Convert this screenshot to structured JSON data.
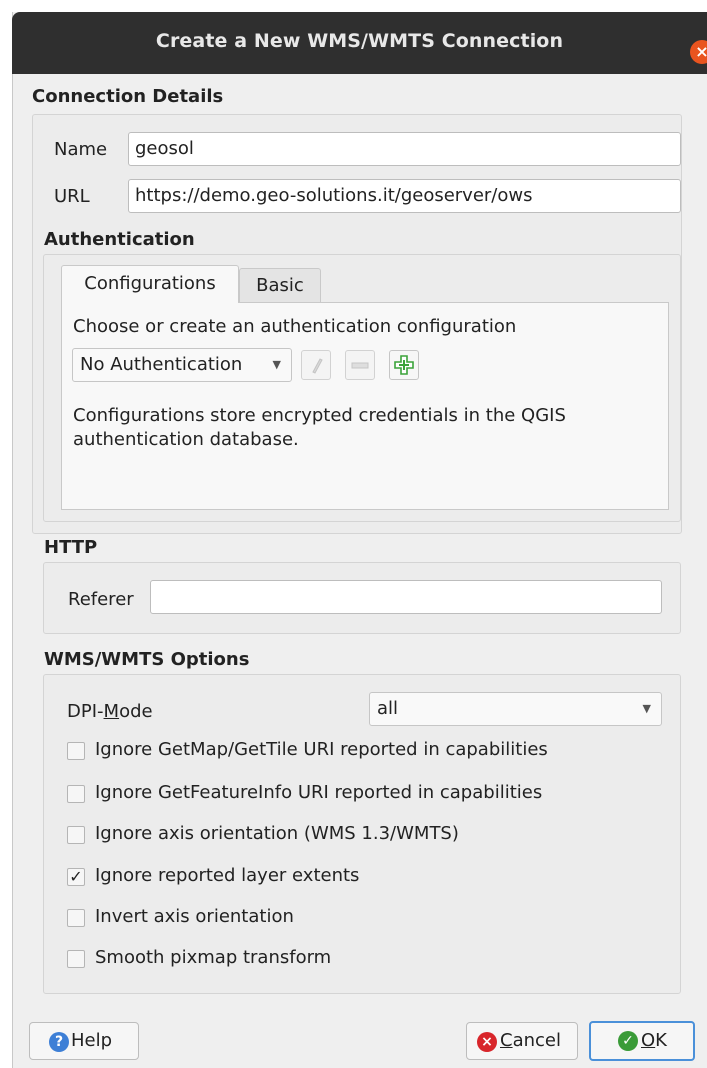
{
  "window": {
    "title": "Create a New WMS/WMTS Connection",
    "close_glyph": "×"
  },
  "connection": {
    "heading": "Connection Details",
    "name_label": "Name",
    "name_value": "geosol",
    "url_label": "URL",
    "url_value": "https://demo.geo-solutions.it/geoserver/ows"
  },
  "auth": {
    "heading": "Authentication",
    "tabs": [
      {
        "label": "Configurations",
        "active": true
      },
      {
        "label": "Basic",
        "active": false
      }
    ],
    "prompt": "Choose or create an authentication configuration",
    "selected": "No Authentication",
    "info_line1": "Configurations store encrypted credentials in the QGIS",
    "info_line2": "authentication database."
  },
  "http": {
    "heading": "HTTP",
    "referer_label": "Referer",
    "referer_value": ""
  },
  "options": {
    "heading": "WMS/WMTS Options",
    "dpi_label_pre": "DPI-",
    "dpi_label_ul": "M",
    "dpi_label_post": "ode",
    "dpi_value": "all",
    "checkboxes": [
      {
        "label": "Ignore GetMap/GetTile URI reported in capabilities",
        "checked": false
      },
      {
        "label": "Ignore GetFeatureInfo URI reported in capabilities",
        "checked": false
      },
      {
        "label": "Ignore axis orientation (WMS 1.3/WMTS)",
        "checked": false
      },
      {
        "label": "Ignore reported layer extents",
        "checked": true
      },
      {
        "label": "Invert axis orientation",
        "checked": false
      },
      {
        "label": "Smooth pixmap transform",
        "checked": false
      }
    ]
  },
  "buttons": {
    "help": "Help",
    "cancel_ul": "C",
    "cancel_rest": "ancel",
    "ok_ul": "O",
    "ok_rest": "K"
  },
  "colors": {
    "help_icon": "#3d7fd6",
    "cancel_icon": "#d8262b",
    "ok_icon": "#3a9b38",
    "add_icon": "#3ba33a",
    "ok_border": "#4a90d9"
  }
}
